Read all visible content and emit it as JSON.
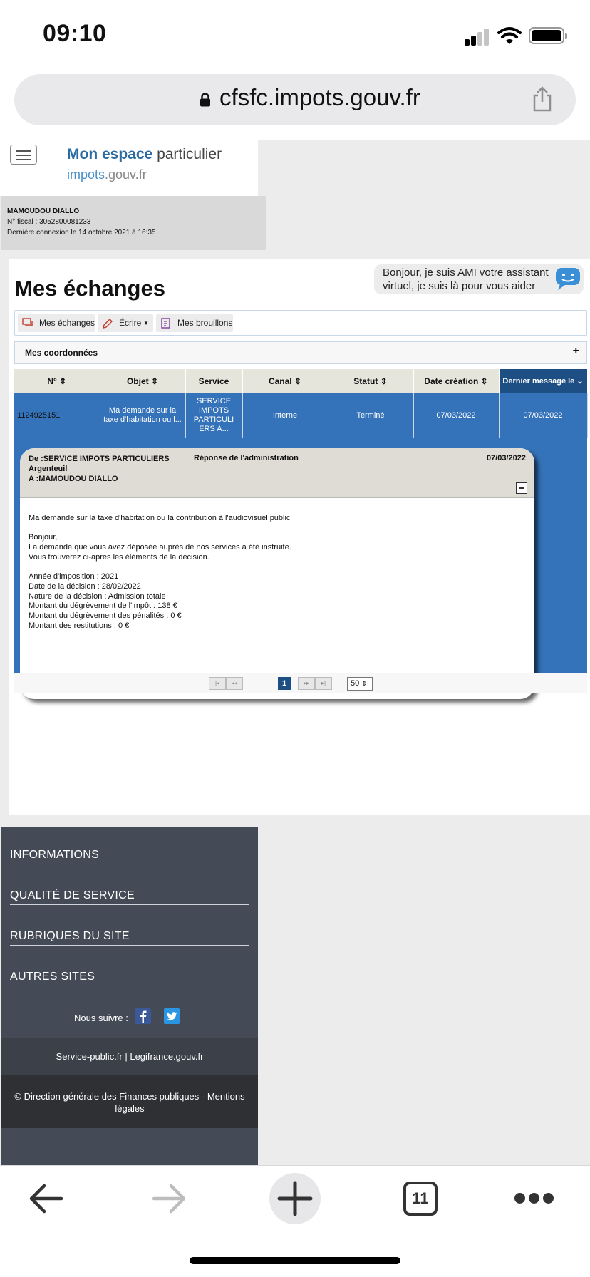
{
  "status_bar": {
    "time": "09:10"
  },
  "browser": {
    "url": "cfsfc.impots.gouv.fr",
    "open_tabs": "11"
  },
  "site": {
    "logo_title_bold": "Mon espace",
    "logo_title_light": "particulier",
    "logo_site_main": "impots",
    "logo_site_light": ".gouv.fr"
  },
  "user": {
    "name": "MAMOUDOU DIALLO",
    "fiscal_number": "N° fiscal : 3052800081233",
    "last_login": "Dernière connexion le 14 octobre 2021 à 16:35"
  },
  "main": {
    "title": "Mes échanges",
    "ami_message": "Bonjour, je suis AMI votre assistant virtuel, je suis là pour vous aider"
  },
  "toolbar": {
    "exchanges_label": "Mes échanges",
    "write_label": "Écrire",
    "drafts_label": "Mes brouillons"
  },
  "coordinates": {
    "label": "Mes coordonnées",
    "toggle": "+"
  },
  "table": {
    "headers": {
      "num": "N°",
      "objet": "Objet",
      "service": "Service",
      "canal": "Canal",
      "statut": "Statut",
      "date_creation": "Date création",
      "last_message": "Dernier message le"
    },
    "row": {
      "num": "1124925151",
      "objet": "Ma demande sur la taxe d'habitation ou l...",
      "service": "SERVICE IMPOTS PARTICULI ERS A...",
      "canal": "Interne",
      "statut": "Terminé",
      "date_creation": "07/03/2022",
      "last_message": "07/03/2022"
    }
  },
  "message": {
    "from_line1": "De :SERVICE IMPOTS PARTICULIERS",
    "from_line2": "Argenteuil",
    "to": "A :MAMOUDOU DIALLO",
    "type": "Réponse de l'administration",
    "date": "07/03/2022",
    "subject": "Ma demande sur la taxe d'habitation ou la contribution à l'audiovisuel public",
    "greeting": "Bonjour,",
    "body1": "La demande que vous avez déposée auprès de nos services a été instruite.",
    "body2": "Vous trouverez ci-après les éléments de la décision.",
    "year": "Année d'imposition : 2021",
    "decision_date": "Date de la décision : 28/02/2022",
    "nature": "Nature de la décision : Admission totale",
    "tax_relief": "Montant du dégrèvement de l'impôt : 138 €",
    "penalty_relief": "Montant du dégrèvement des pénalités : 0 €",
    "refunds": "Montant des restitutions : 0 €"
  },
  "pagination": {
    "first": "|◂",
    "prev": "◂◂",
    "current": "1",
    "next": "▸▸",
    "last": "▸|",
    "page_size": "50"
  },
  "footer": {
    "links": [
      "INFORMATIONS",
      "QUALITÉ DE SERVICE",
      "RUBRIQUES DU SITE",
      "AUTRES SITES"
    ],
    "follow_label": "Nous suivre :",
    "sites": "Service-public.fr | Legifrance.gouv.fr",
    "copyright": "© Direction générale des Finances publiques - Mentions légales"
  },
  "colors": {
    "brand_blue": "#2d6ca2",
    "table_blue": "#3472b9",
    "header_navy": "#1d4e84",
    "footer_grey": "#454b56"
  }
}
